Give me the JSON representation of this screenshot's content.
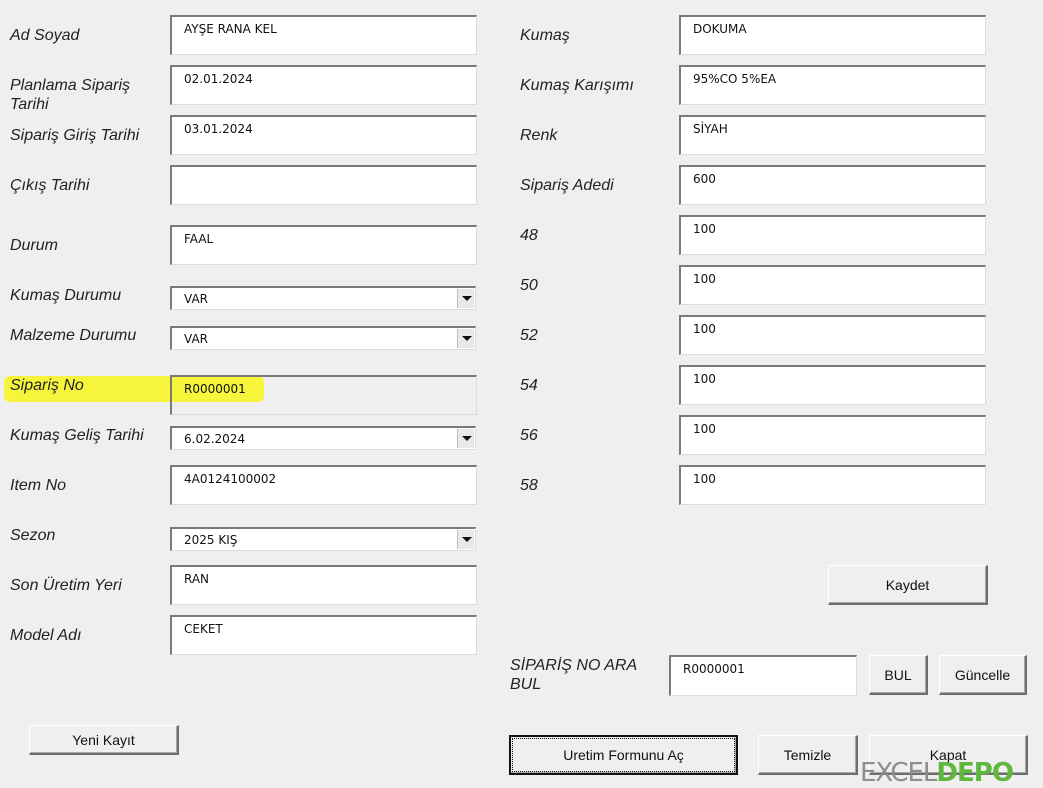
{
  "left_fields": {
    "ad_soyad": {
      "label": "Ad Soyad",
      "value": "AYŞE RANA KEL"
    },
    "planlama": {
      "label": "Planlama Sipariş Tarihi",
      "value": "02.01.2024"
    },
    "siparis_giris": {
      "label": "Sipariş Giriş Tarihi",
      "value": "03.01.2024"
    },
    "cikis": {
      "label": "Çıkış Tarihi",
      "value": ""
    },
    "durum": {
      "label": "Durum",
      "value": "FAAL"
    },
    "kumas_durumu": {
      "label": "Kumaş Durumu",
      "value": "VAR"
    },
    "malzeme_durumu": {
      "label": "Malzeme Durumu",
      "value": "VAR"
    },
    "siparis_no": {
      "label": "Sipariş No",
      "value": "R0000001"
    },
    "kumas_gelis": {
      "label": "Kumaş Geliş Tarihi",
      "value": "6.02.2024"
    },
    "item_no": {
      "label": "Item No",
      "value": "4A0124100002"
    },
    "sezon": {
      "label": "Sezon",
      "value": "2025 KIŞ"
    },
    "son_uretim": {
      "label": "Son Üretim Yeri",
      "value": "RAN"
    },
    "model_adi": {
      "label": "Model Adı",
      "value": "CEKET"
    }
  },
  "right_fields": {
    "kumas": {
      "label": "Kumaş",
      "value": "DOKUMA"
    },
    "karisim": {
      "label": "Kumaş Karışımı",
      "value": "95%CO 5%EA"
    },
    "renk": {
      "label": "Renk",
      "value": "SİYAH"
    },
    "adet": {
      "label": "Sipariş Adedi",
      "value": "600"
    },
    "s48": {
      "label": "48",
      "value": "100"
    },
    "s50": {
      "label": "50",
      "value": "100"
    },
    "s52": {
      "label": "52",
      "value": "100"
    },
    "s54": {
      "label": "54",
      "value": "100"
    },
    "s56": {
      "label": "56",
      "value": "100"
    },
    "s58": {
      "label": "58",
      "value": "100"
    }
  },
  "search": {
    "label": "SİPARİŞ NO ARA BUL",
    "value": "R0000001"
  },
  "buttons": {
    "kaydet": "Kaydet",
    "bul": "BUL",
    "guncelle": "Güncelle",
    "yeni_kayit": "Yeni Kayıt",
    "uretim_formu": "Uretim Formunu Aç",
    "temizle": "Temizle",
    "kapat": "Kapat"
  },
  "highlight_color": "#f6f432",
  "watermark": {
    "part1": "EXCEL",
    "part2": "DEPO"
  }
}
